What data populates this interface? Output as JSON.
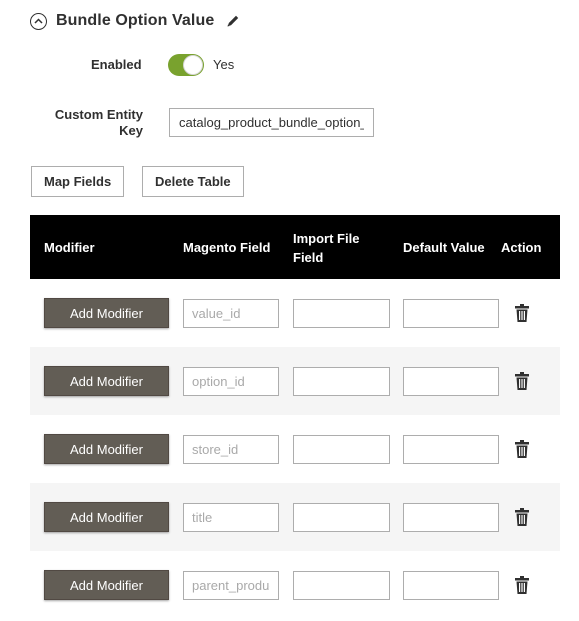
{
  "section": {
    "title": "Bundle Option Value",
    "collapse_icon": "chevron-up-circle-icon",
    "edit_icon": "pencil-icon"
  },
  "fields": {
    "enabled_label": "Enabled",
    "enabled_value": "Yes",
    "enabled_on": true,
    "entity_key_label_line1": "Custom Entity",
    "entity_key_label_line2": "Key",
    "entity_key_value": "catalog_product_bundle_option_value"
  },
  "buttons": {
    "map_fields": "Map Fields",
    "delete_table": "Delete Table"
  },
  "table": {
    "headers": {
      "modifier": "Modifier",
      "magento_field": "Magento Field",
      "import_line1": "Import File",
      "import_line2": "Field",
      "default_value": "Default Value",
      "action": "Action"
    },
    "rows": [
      {
        "add_label": "Add Modifier",
        "magento_placeholder": "value_id",
        "import_value": "",
        "default_value": ""
      },
      {
        "add_label": "Add Modifier",
        "magento_placeholder": "option_id",
        "import_value": "",
        "default_value": ""
      },
      {
        "add_label": "Add Modifier",
        "magento_placeholder": "store_id",
        "import_value": "",
        "default_value": ""
      },
      {
        "add_label": "Add Modifier",
        "magento_placeholder": "title",
        "import_value": "",
        "default_value": ""
      },
      {
        "add_label": "Add Modifier",
        "magento_placeholder": "parent_product_id",
        "import_value": "",
        "default_value": ""
      }
    ]
  },
  "colors": {
    "toggle_on": "#79a22e",
    "header_bg": "#000000",
    "add_button_bg": "#625d55",
    "row_alt_bg": "#f5f5f5"
  }
}
